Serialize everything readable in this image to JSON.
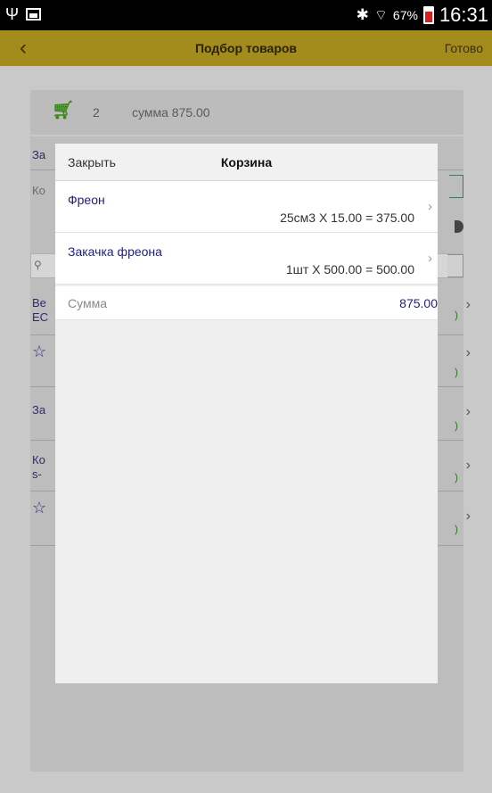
{
  "statusbar": {
    "battery_pct": "67%",
    "time": "16:31"
  },
  "header": {
    "back_icon": "chevron-left-icon",
    "title": "Подбор товаров",
    "done_label": "Готово"
  },
  "background": {
    "cart_count": "2",
    "cart_sum": "сумма 875.00",
    "labels": [
      "За",
      "Ко",
      "Ве",
      "ЕС",
      "За",
      "Ко",
      "s-"
    ]
  },
  "modal": {
    "close_label": "Закрыть",
    "title": "Корзина",
    "items": [
      {
        "name": "Фреон",
        "calc": "25см3 X 15.00 = 375.00"
      },
      {
        "name": "Закачка фреона",
        "calc": "1шт X 500.00 = 500.00"
      }
    ],
    "sum_label": "Сумма",
    "sum_value": "875.00"
  },
  "colors": {
    "appbar": "#a38b1c",
    "link_blue": "#1e1e7e",
    "cart_green": "#3a8a1a"
  }
}
